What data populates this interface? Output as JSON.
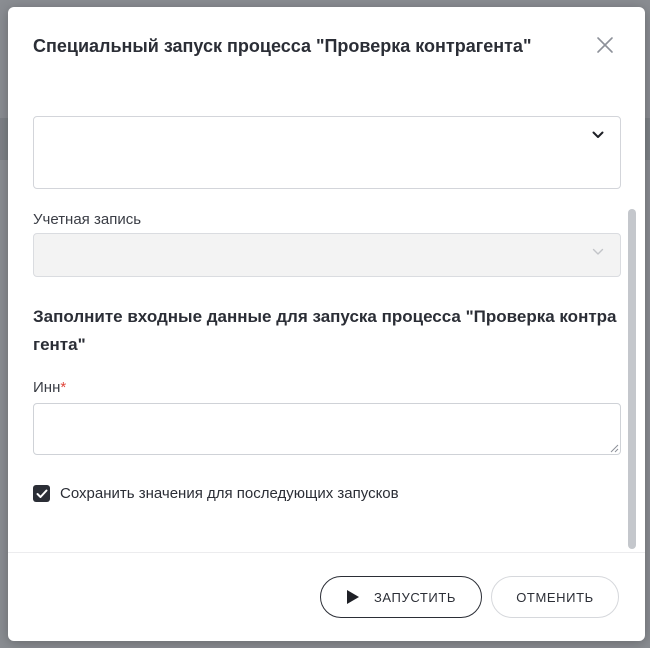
{
  "dialog": {
    "title": "Специальный запуск процесса \"Проверка контрагента\""
  },
  "form": {
    "process_select": {
      "value": ""
    },
    "account": {
      "label": "Учетная запись",
      "value": ""
    },
    "section_heading": "Заполните входные данные для запуска процесса \"Проверка контрагента\"",
    "inn": {
      "label": "Инн",
      "required_mark": "*",
      "value": ""
    },
    "save_values": {
      "label": "Сохранить значения для последующих запусков",
      "checked": true
    }
  },
  "footer": {
    "run_label": "ЗАПУСТИТЬ",
    "cancel_label": "ОТМЕНИТЬ"
  },
  "colors": {
    "primary_dark": "#2b2e36",
    "required": "#e0463b",
    "disabled_bg": "#f3f3f3",
    "border": "#d3d5da"
  },
  "icons": {
    "close": "close-icon",
    "dropdown": "chevron-down-icon",
    "checkbox": "check-icon",
    "run": "play-icon",
    "resize": "resize-grip-icon"
  }
}
